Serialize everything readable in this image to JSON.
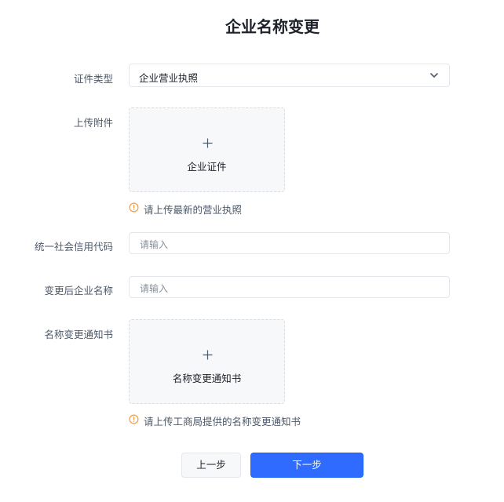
{
  "page": {
    "title": "企业名称变更"
  },
  "form": {
    "cert_type": {
      "label": "证件类型",
      "value": "企业营业执照",
      "icon": "chevron-down-icon"
    },
    "attachment": {
      "label": "上传附件",
      "caption": "企业证件",
      "hint": "请上传最新的营业执照"
    },
    "credit_code": {
      "label": "统一社会信用代码",
      "placeholder": "请输入"
    },
    "new_name": {
      "label": "变更后企业名称",
      "placeholder": "请输入"
    },
    "notice": {
      "label": "名称变更通知书",
      "caption": "名称变更通知书",
      "hint": "请上传工商局提供的名称变更通知书"
    }
  },
  "actions": {
    "prev_label": "上一步",
    "next_label": "下一步"
  },
  "colors": {
    "primary": "#2f6bff",
    "warning": "#ff9a2e",
    "border": "#e5e6eb"
  }
}
